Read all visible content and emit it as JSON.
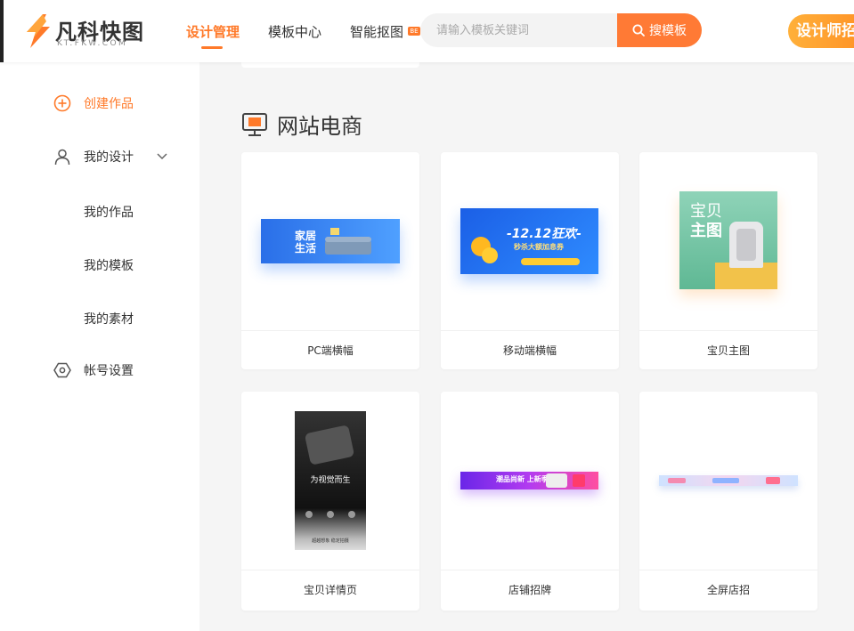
{
  "brand": {
    "name": "凡科快图",
    "domain": "KT.FKW.COM"
  },
  "nav": {
    "items": [
      "设计管理",
      "模板中心",
      "智能抠图"
    ],
    "badge": "BE"
  },
  "search": {
    "placeholder": "请输入模板关键词",
    "button": "搜模板"
  },
  "designer_button": "设计师招募",
  "sidebar": {
    "create": "创建作品",
    "my_design": "我的设计",
    "sub_items": [
      "我的作品",
      "我的模板",
      "我的素材"
    ],
    "account": "帐号设置"
  },
  "section": {
    "title": "网站电商"
  },
  "cards": [
    {
      "label": "PC端横幅",
      "thumb": {
        "t1": "家居",
        "t2": "生活"
      }
    },
    {
      "label": "移动端横幅",
      "thumb": {
        "t1": "-12.12狂欢-",
        "t2": "秒杀大额加息券"
      }
    },
    {
      "label": "宝贝主图",
      "thumb": {
        "t1": "宝贝",
        "t2": "主图"
      }
    },
    {
      "label": "宝贝详情页",
      "thumb": {
        "t1": "为视觉而生",
        "t2": "超越想象 稳定拍摄"
      }
    },
    {
      "label": "店铺招牌",
      "thumb": {
        "t1": "潮品尚新 上新季"
      }
    },
    {
      "label": "全屏店招",
      "thumb": {}
    }
  ],
  "colors": {
    "accent": "#ff7a2a",
    "search_button": "#ff7a35",
    "blue": "#2f7cf6"
  }
}
